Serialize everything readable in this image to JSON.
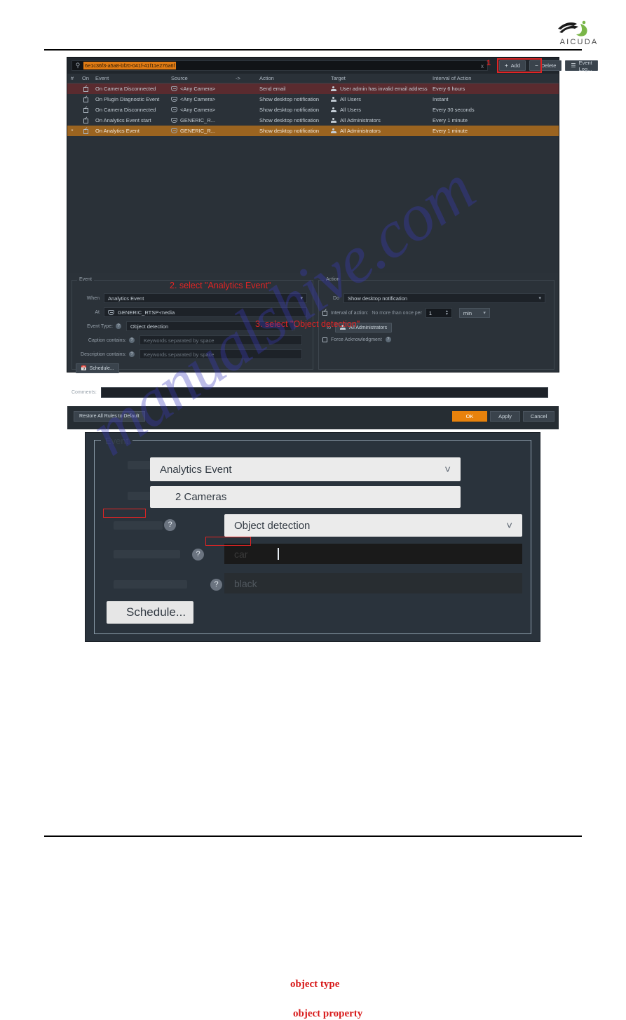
{
  "brand": {
    "name": "AICUDA",
    "logo_icon": "aicuda-swoosh-logo"
  },
  "screenshot1": {
    "search": {
      "value": "6e1c36f3-a5a8-bf20-041f-41f11e276a6f",
      "clear_label": "x",
      "icon": "search-icon"
    },
    "annotation_step1": "1",
    "toolbar": {
      "add_label": "Add",
      "delete_label": "Delete",
      "event_log_label": "Event Log..."
    },
    "table": {
      "headers": [
        "#",
        "On",
        "Event",
        "Source",
        "->",
        "Action",
        "Target",
        "Interval of Action"
      ],
      "rows": [
        {
          "num": "",
          "on": true,
          "event": "On Camera Disconnected",
          "source": "<Any Camera>",
          "action": "Send email",
          "target": "User admin has invalid email address",
          "interval": "Every 6 hours",
          "state": "error"
        },
        {
          "num": "",
          "on": true,
          "event": "On Plugin Diagnostic Event",
          "source": "<Any Camera>",
          "action": "Show desktop notification",
          "target": "All Users",
          "interval": "Instant",
          "state": "normal"
        },
        {
          "num": "",
          "on": true,
          "event": "On Camera Disconnected",
          "source": "<Any Camera>",
          "action": "Show desktop notification",
          "target": "All Users",
          "interval": "Every 30 seconds",
          "state": "normal"
        },
        {
          "num": "",
          "on": true,
          "event": "On Analytics Event start",
          "source": "GENERIC_R...",
          "action": "Show desktop notification",
          "target": "All Administrators",
          "interval": "Every 1 minute",
          "state": "normal"
        },
        {
          "num": "*",
          "on": true,
          "event": "On Analytics Event",
          "source": "GENERIC_R...",
          "action": "Show desktop notification",
          "target": "All Administrators",
          "interval": "Every 1 minute",
          "state": "selected"
        }
      ]
    },
    "event_group": {
      "title": "Event",
      "when_label": "When",
      "when_value": "Analytics Event",
      "at_label": "At",
      "at_value": "GENERIC_RTSP-media",
      "event_type_label": "Event Type:",
      "event_type_value": "Object detection",
      "caption_label": "Caption contains:",
      "caption_placeholder": "Keywords separated by space",
      "description_label": "Description contains:",
      "description_placeholder": "Keywords separated by space",
      "schedule_label": "Schedule..."
    },
    "action_group": {
      "title": "Action",
      "do_label": "Do",
      "do_value": "Show desktop notification",
      "interval_label": "Interval of action:",
      "interval_sub": "No more than once per",
      "interval_value": "1",
      "interval_unit": "min",
      "to_label": "to",
      "to_value": "All Administrators",
      "force_ack_label": "Force Acknowledgment"
    },
    "comments_label": "Comments:",
    "comments_value": "",
    "footer": {
      "restore_label": "Restore All Rules to Default",
      "ok_label": "OK",
      "apply_label": "Apply",
      "cancel_label": "Cancel"
    },
    "annotations": [
      {
        "text": "2. select \"Analytics Event\""
      },
      {
        "text": "3. select \"Object detection\""
      }
    ]
  },
  "screenshot2": {
    "group_title": "Event",
    "when_value": "Analytics Event",
    "at_value": "2 Cameras",
    "event_type_value": "Object detection",
    "object_type_value": "car",
    "object_property_value": "black",
    "schedule_label": "Schedule...",
    "annotations": {
      "object_type": "object type",
      "object_property": "object property"
    }
  },
  "watermark": {
    "text": "manualshive.com"
  },
  "colors": {
    "accent_orange": "#e8820c",
    "annotation_red": "#e02424",
    "selected_row": "#9b6420",
    "error_row": "#5a2b2f",
    "dialog_bg": "#2a3138",
    "brand_green": "#7ab648"
  }
}
